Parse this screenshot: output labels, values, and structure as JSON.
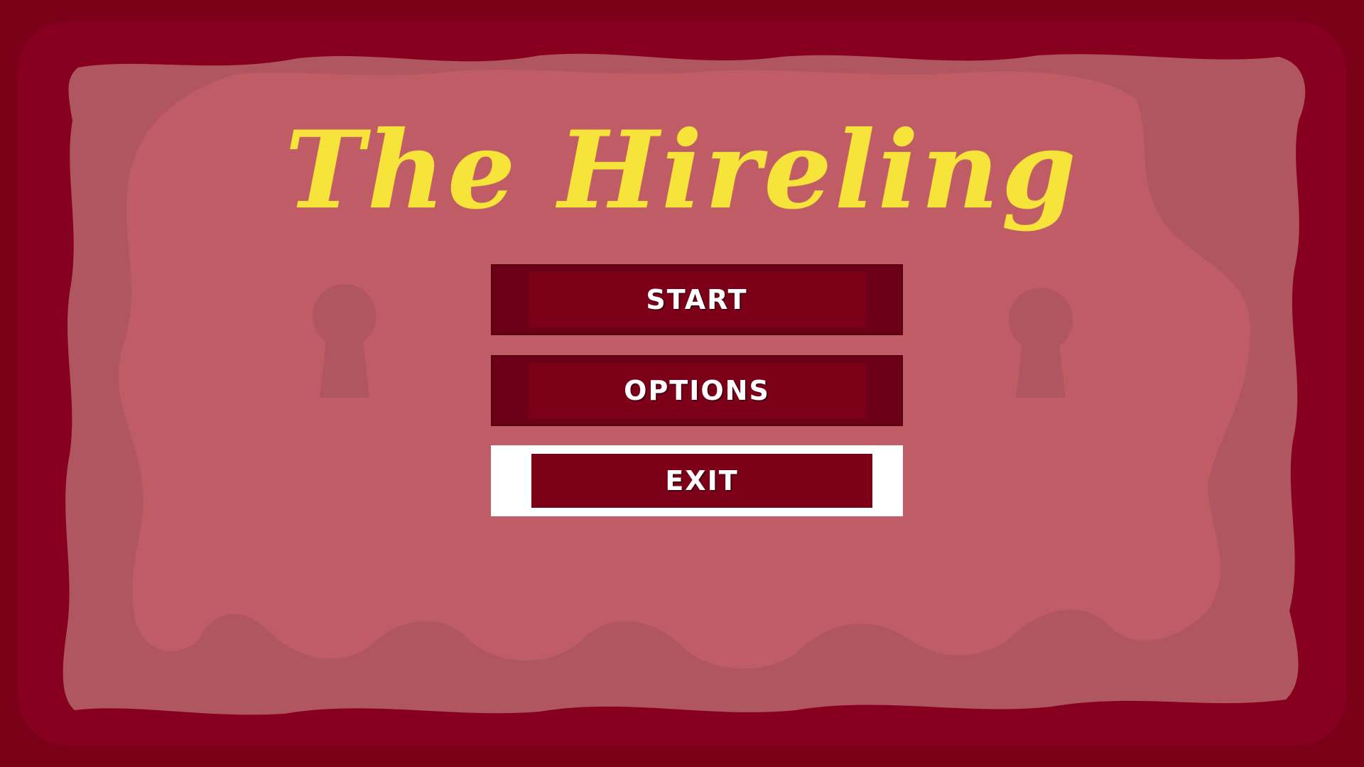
{
  "game": {
    "title": "The Hireling"
  },
  "menu": {
    "items": [
      {
        "label": "START",
        "selected": false
      },
      {
        "label": "OPTIONS",
        "selected": false
      },
      {
        "label": "EXIT",
        "selected": true
      }
    ]
  },
  "colors": {
    "frame": "#7a0018",
    "parchment_outer": "#b05661",
    "parchment_inner": "#c05c65",
    "title": "#f7e43a",
    "button": "#7c0018",
    "button_edge": "#6c0016",
    "selected_border": "#ffffff",
    "label": "#ffffff"
  }
}
